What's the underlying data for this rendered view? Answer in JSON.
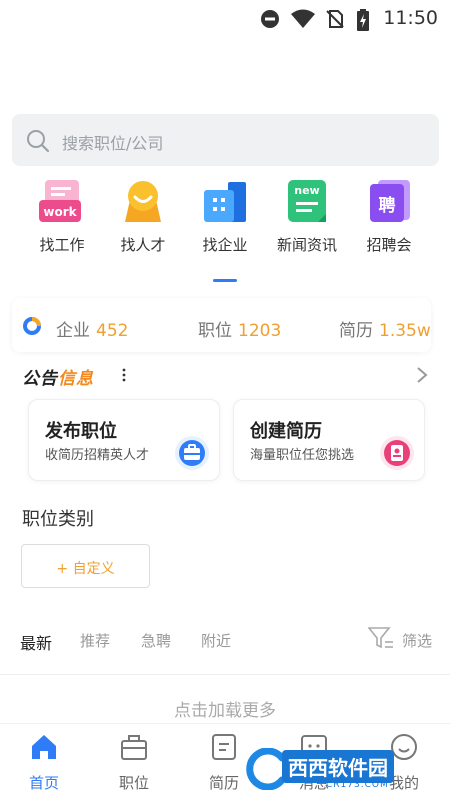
{
  "status_bar": {
    "time": "11:50"
  },
  "search": {
    "placeholder": "搜索职位/公司"
  },
  "quick_nav": [
    {
      "label": "找工作",
      "icon": "work-icon",
      "badge": "work"
    },
    {
      "label": "找人才",
      "icon": "talent-icon"
    },
    {
      "label": "找企业",
      "icon": "enterprise-icon"
    },
    {
      "label": "新闻资讯",
      "icon": "news-icon",
      "badge": "new"
    },
    {
      "label": "招聘会",
      "icon": "job-fair-icon",
      "badge": "聘"
    }
  ],
  "stats": {
    "company_label": "企业",
    "company_value": "452",
    "position_label": "职位",
    "position_value": "1203",
    "resume_label": "简历",
    "resume_value": "1.35w"
  },
  "notice": {
    "title_a": "公告",
    "title_b": "信息"
  },
  "cards": [
    {
      "title": "发布职位",
      "subtitle": "收简历招精英人才",
      "icon": "briefcase-icon",
      "color": "#2f7df6"
    },
    {
      "title": "创建简历",
      "subtitle": "海量职位任您挑选",
      "icon": "resume-icon",
      "color": "#e9407a"
    }
  ],
  "category": {
    "title": "职位类别",
    "custom_button": "+ 自定义"
  },
  "filter_tabs": [
    "最新",
    "推荐",
    "急聘",
    "附近"
  ],
  "filter_button": "筛选",
  "load_more": "点击加载更多",
  "bottom_nav": [
    {
      "label": "首页",
      "icon": "home-icon",
      "active": true
    },
    {
      "label": "职位",
      "icon": "briefcase-icon"
    },
    {
      "label": "简历",
      "icon": "resume-icon"
    },
    {
      "label": "消息",
      "icon": "message-icon"
    },
    {
      "label": "我的",
      "icon": "profile-icon"
    }
  ],
  "watermark": {
    "text_a": "西西",
    "text_b": "软件园",
    "sub": "CR173.COM"
  },
  "colors": {
    "accent": "#2f7df6",
    "number": "#f0a030",
    "notice_accent": "#f28a1f"
  }
}
